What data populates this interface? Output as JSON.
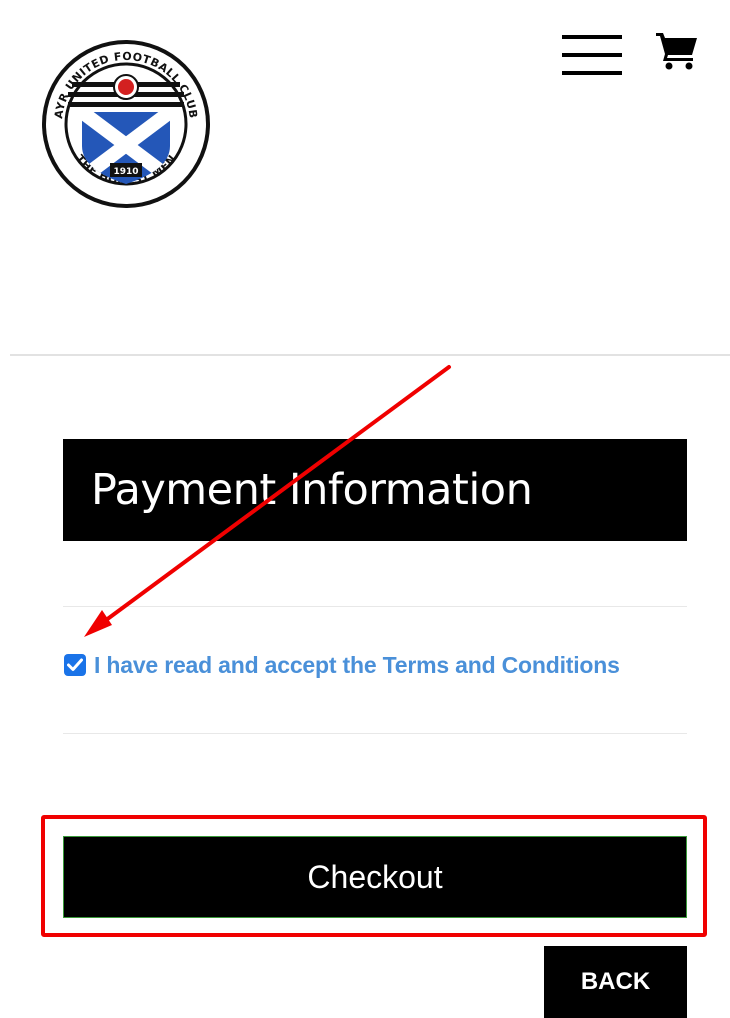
{
  "header": {
    "logo": {
      "ring_text_top": "AYR UNITED FOOTBALL CLUB",
      "ring_text_bottom": "THE HONEST MEN",
      "year": "1910",
      "icon": "club-crest"
    },
    "menu_icon": "hamburger-menu-icon",
    "cart_icon": "shopping-cart-icon"
  },
  "payment": {
    "heading": "Payment Information",
    "terms_prefix": "I have read and accept the ",
    "terms_link": "Terms and Conditions",
    "terms_checked": true
  },
  "actions": {
    "checkout_label": "Checkout",
    "back_label": "BACK"
  },
  "colors": {
    "annotation_red": "#f00000",
    "link_blue": "#4a90d9",
    "checkbox_blue": "#1a73e8",
    "button_black": "#000000"
  }
}
